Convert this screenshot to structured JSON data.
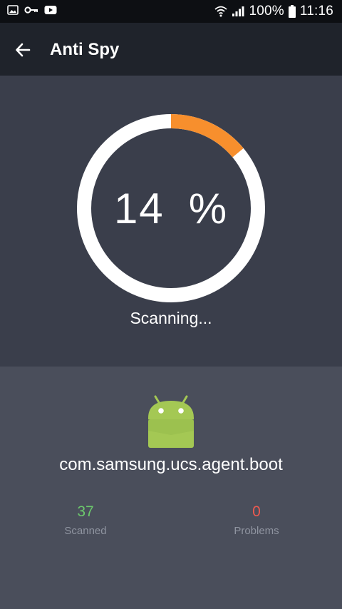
{
  "status_bar": {
    "battery": "100%",
    "time": "11:16"
  },
  "appbar": {
    "title": "Anti Spy"
  },
  "scan": {
    "progress_percent": 14,
    "percent_value": "14",
    "percent_sign": "%",
    "status_text": "Scanning...",
    "colors": {
      "progress": "#f78f2d",
      "track": "#ffffff"
    }
  },
  "current_item": {
    "package_name": "com.samsung.ucs.agent.boot",
    "icon": "android-icon"
  },
  "stats": {
    "scanned_value": "37",
    "scanned_label": "Scanned",
    "problems_value": "0",
    "problems_label": "Problems",
    "colors": {
      "scanned": "#6cc86c",
      "problems": "#ee5a50"
    }
  }
}
